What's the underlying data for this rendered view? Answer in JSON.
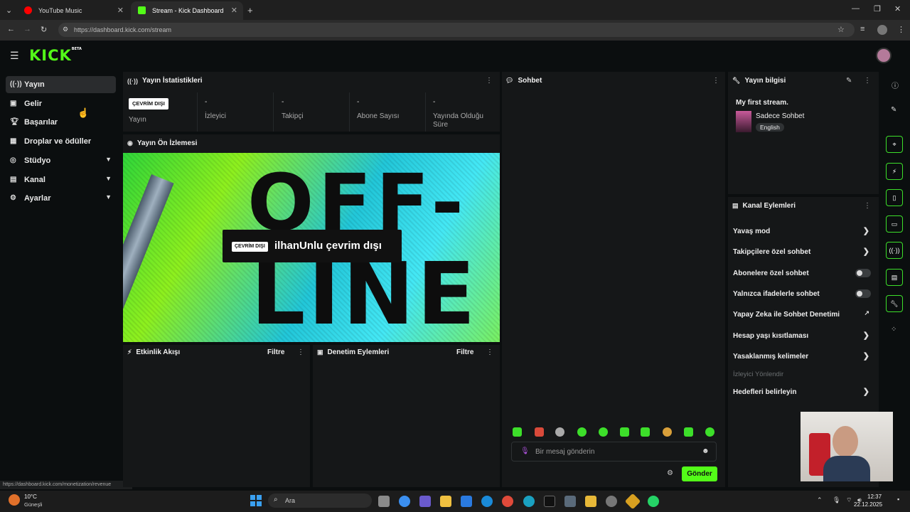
{
  "browser": {
    "tabs": [
      {
        "title": "YouTube Music",
        "active": false
      },
      {
        "title": "Stream - Kick Dashboard",
        "active": true
      }
    ],
    "url": "https://dashboard.kick.com/stream",
    "status_url": "https://dashboard.kick.com/monetization/revenue"
  },
  "header": {
    "logo": "KICK",
    "logo_badge": "BETA"
  },
  "sidebar": {
    "items": [
      {
        "label": "Yayın",
        "icon": "broadcast-icon",
        "active": true
      },
      {
        "label": "Gelir",
        "icon": "revenue-icon"
      },
      {
        "label": "Başarılar",
        "icon": "trophy-icon"
      },
      {
        "label": "Droplar ve ödüller",
        "icon": "drops-icon"
      },
      {
        "label": "Stüdyo",
        "icon": "studio-icon",
        "expandable": true
      },
      {
        "label": "Kanal",
        "icon": "channel-icon",
        "expandable": true
      },
      {
        "label": "Ayarlar",
        "icon": "gear-icon",
        "expandable": true
      }
    ]
  },
  "stats": {
    "title": "Yayın İstatistikleri",
    "offline_badge": "ÇEVRİM DIŞI",
    "cells": [
      {
        "value": "",
        "label": "Yayın"
      },
      {
        "value": "-",
        "label": "İzleyici"
      },
      {
        "value": "-",
        "label": "Takipçi"
      },
      {
        "value": "-",
        "label": "Abone Sayısı"
      },
      {
        "value": "-",
        "label": "Yayında Olduğu Süre"
      }
    ]
  },
  "preview": {
    "title": "Yayın Ön İzlemesi",
    "badge": "ÇEVRİM DIŞI",
    "message": "ilhanUnlu çevrim dışı",
    "art_word_top": "OFF-",
    "art_word_bottom": "LINE"
  },
  "activity": {
    "title": "Etkinlik Akışı",
    "filter": "Filtre"
  },
  "moderation": {
    "title": "Denetim Eylemleri",
    "filter": "Filtre"
  },
  "chat": {
    "title": "Sohbet",
    "placeholder": "Bir mesaj gönderin",
    "send": "Gönder"
  },
  "stream_info": {
    "title": "Yayın bilgisi",
    "stream_title": "My first stream.",
    "category": "Sadece Sohbet",
    "language": "English"
  },
  "channel_actions": {
    "title": "Kanal Eylemleri",
    "items": [
      {
        "label": "Yavaş mod",
        "control": "chevron"
      },
      {
        "label": "Takipçilere özel sohbet",
        "control": "chevron"
      },
      {
        "label": "Abonelere özel sohbet",
        "control": "toggle",
        "on": false
      },
      {
        "label": "Yalnızca ifadelerle sohbet",
        "control": "toggle",
        "on": false
      },
      {
        "label": "Yapay Zeka ile Sohbet Denetimi",
        "control": "external"
      },
      {
        "label": "Hesap yaşı kısıtlaması",
        "control": "chevron"
      },
      {
        "label": "Yasaklanmış kelimeler",
        "control": "chevron"
      },
      {
        "label": "İzleyici Yönlendir",
        "control": "none",
        "disabled": true
      },
      {
        "label": "Hedefleri belirleyin",
        "control": "chevron"
      }
    ]
  },
  "taskbar": {
    "weather_temp": "10°C",
    "weather_text": "Güneşli",
    "search": "Ara",
    "time": "12:37",
    "date": "22.12.2025"
  },
  "colors": {
    "accent": "#53fc18",
    "panel": "#151718",
    "background": "#0b0e0f"
  }
}
